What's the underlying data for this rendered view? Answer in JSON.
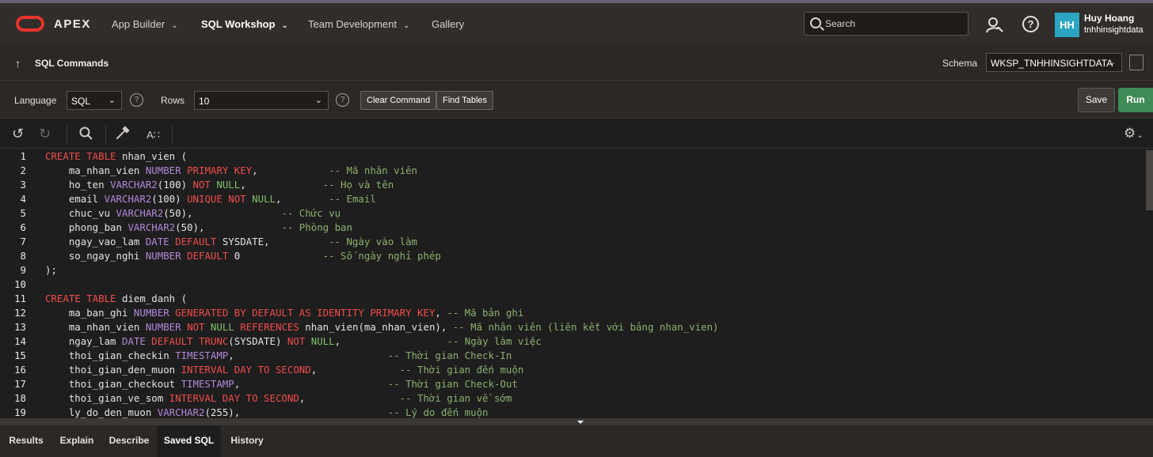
{
  "app": {
    "name": "APEX"
  },
  "nav": [
    {
      "label": "App Builder",
      "has_menu": true
    },
    {
      "label": "SQL Workshop",
      "has_menu": true,
      "active": true
    },
    {
      "label": "Team Development",
      "has_menu": true
    },
    {
      "label": "Gallery",
      "has_menu": false
    }
  ],
  "search": {
    "placeholder": "Search"
  },
  "user": {
    "initials": "HH",
    "name": "Huy Hoang",
    "workspace": "tnhhinsightdata"
  },
  "page": {
    "title": "SQL Commands"
  },
  "schema": {
    "label": "Schema",
    "value": "WKSP_TNHHINSIGHTDATA"
  },
  "toolbar": {
    "language_label": "Language",
    "language_value": "SQL",
    "rows_label": "Rows",
    "rows_value": "10",
    "clear_label": "Clear Command",
    "find_label": "Find Tables",
    "save_label": "Save",
    "run_label": "Run"
  },
  "editor_lines": [
    "1",
    "2",
    "3",
    "4",
    "5",
    "6",
    "7",
    "8",
    "9",
    "10",
    "11",
    "12",
    "13",
    "14",
    "15",
    "16",
    "17",
    "18",
    "19"
  ],
  "code": {
    "l1": [
      "CREATE TABLE",
      " nhan_vien ("
    ],
    "l2": [
      "ma_nhan_vien ",
      "NUMBER",
      " ",
      "PRIMARY KEY",
      ",",
      "            -- Mã nhân viên"
    ],
    "l3": [
      "ho_ten ",
      "VARCHAR2",
      "(100) ",
      "NOT",
      " ",
      "NULL",
      ",",
      "             -- Họ và tên"
    ],
    "l4": [
      "email ",
      "VARCHAR2",
      "(100) ",
      "UNIQUE NOT",
      " ",
      "NULL",
      ",",
      "        -- Email"
    ],
    "l5": [
      "chuc_vu ",
      "VARCHAR2",
      "(50),",
      "               -- Chức vụ"
    ],
    "l6": [
      "phong_ban ",
      "VARCHAR2",
      "(50),",
      "             -- Phòng ban"
    ],
    "l7": [
      "ngay_vao_lam ",
      "DATE",
      " ",
      "DEFAULT",
      " SYSDATE,",
      "          -- Ngày vào làm"
    ],
    "l8": [
      "so_ngay_nghi ",
      "NUMBER",
      " ",
      "DEFAULT",
      " 0",
      "              -- Số ngày nghỉ phép"
    ],
    "l9": [
      ");"
    ],
    "l11": [
      "CREATE TABLE",
      " diem_danh ("
    ],
    "l12": [
      "ma_ban_ghi ",
      "NUMBER",
      " ",
      "GENERATED BY DEFAULT AS IDENTITY PRIMARY KEY",
      ",",
      " -- Mã bản ghi"
    ],
    "l13": [
      "ma_nhan_vien ",
      "NUMBER",
      " ",
      "NOT",
      " ",
      "NULL",
      " ",
      "REFERENCES",
      " nhan_vien(ma_nhan_vien),",
      " -- Mã nhân viên (liên kết với bảng nhan_vien)"
    ],
    "l14": [
      "ngay_lam ",
      "DATE",
      " ",
      "DEFAULT",
      " ",
      "TRUNC",
      "(SYSDATE) ",
      "NOT",
      " ",
      "NULL",
      ",",
      "                  -- Ngày làm việc"
    ],
    "l15": [
      "thoi_gian_checkin ",
      "TIMESTAMP",
      ",",
      "                          -- Thời gian Check-In"
    ],
    "l16": [
      "thoi_gian_den_muon ",
      "INTERVAL DAY TO SECOND",
      ",",
      "              -- Thời gian đến muộn"
    ],
    "l17": [
      "thoi_gian_checkout ",
      "TIMESTAMP",
      ",",
      "                         -- Thời gian Check-Out"
    ],
    "l18": [
      "thoi_gian_ve_som ",
      "INTERVAL DAY TO SECOND",
      ",",
      "                -- Thời gian về sớm"
    ],
    "l19": [
      "ly_do_den_muon ",
      "VARCHAR2",
      "(255),",
      "                         -- Lý do đến muộn"
    ]
  },
  "bottom_tabs": [
    "Results",
    "Explain",
    "Describe",
    "Saved SQL",
    "History"
  ],
  "active_tab": "Saved SQL",
  "colors": {
    "accent_red": "#e5332a",
    "run_green": "#3e8b56",
    "avatar": "#2ba5c2"
  }
}
